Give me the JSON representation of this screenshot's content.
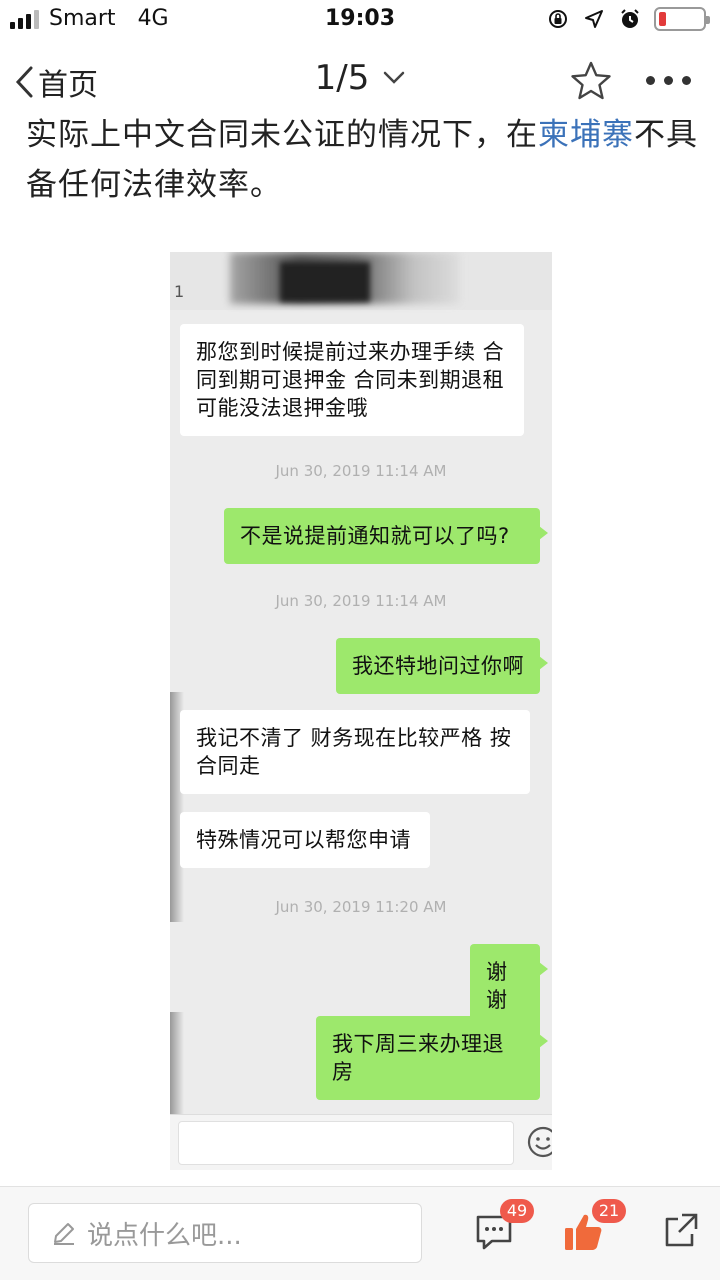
{
  "status_bar": {
    "carrier": "Smart",
    "network": "4G",
    "time": "19:03",
    "battery_level": 0.16
  },
  "nav": {
    "back_label": "首页",
    "page_indicator": "1/5"
  },
  "article": {
    "line1_before": "实际上中文合同未公证的情况下，在",
    "line1_link": "柬埔寨",
    "line1_after": "不具",
    "line2": "备任何法律效率。"
  },
  "chat_screenshot": {
    "header_number": "1",
    "messages": [
      {
        "side": "in",
        "text": "那您到时候提前过来办理手续 合同到期可退押金 合同未到期退租可能没法退押金哦"
      },
      {
        "timestamp": "Jun 30, 2019 11:14 AM"
      },
      {
        "side": "out",
        "text": "不是说提前通知就可以了吗?"
      },
      {
        "timestamp": "Jun 30, 2019 11:14 AM"
      },
      {
        "side": "out",
        "text": "我还特地问过你啊"
      },
      {
        "side": "in",
        "text": "我记不清了 财务现在比较严格 按合同走"
      },
      {
        "side": "in",
        "text": "特殊情况可以帮您申请"
      },
      {
        "timestamp": "Jun 30, 2019 11:20 AM"
      },
      {
        "side": "out",
        "text": "谢谢"
      },
      {
        "side": "out",
        "text": "我下周三来办理退房"
      }
    ],
    "bubble_colors": {
      "incoming": "#ffffff",
      "outgoing": "#9de86c"
    }
  },
  "bottom_bar": {
    "comment_placeholder": "说点什么吧...",
    "comment_count": "49",
    "like_count": "21",
    "accent_color": "#f06a3b"
  }
}
